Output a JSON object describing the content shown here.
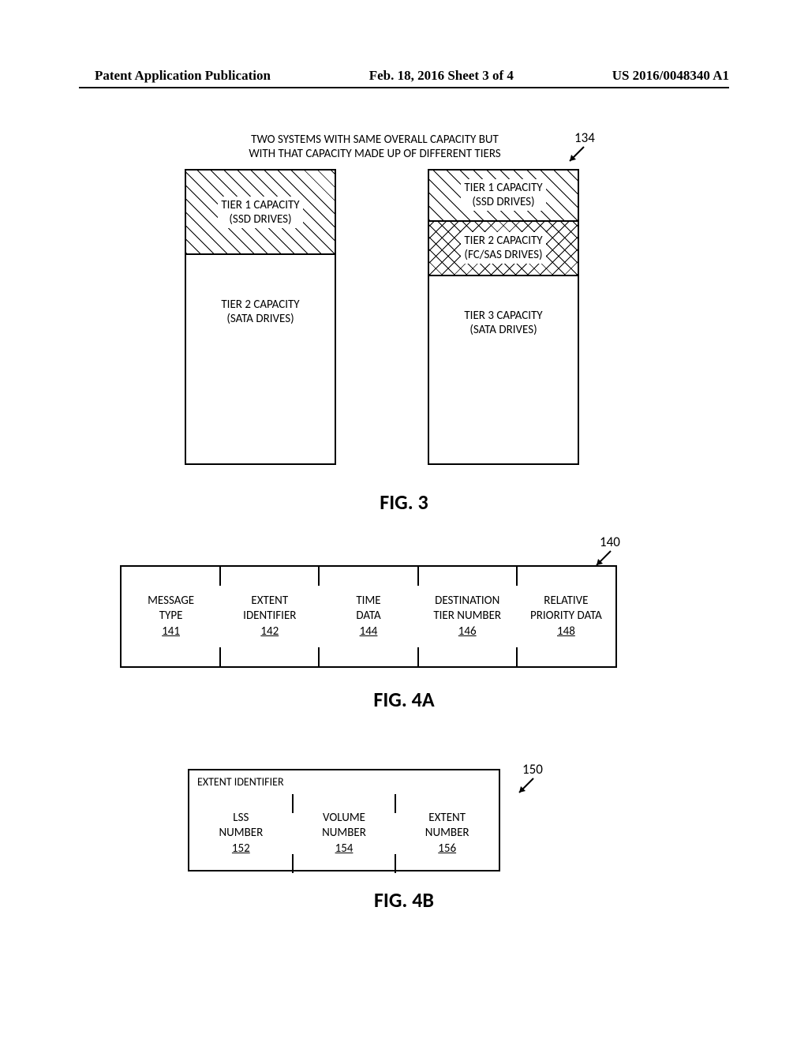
{
  "header": {
    "left": "Patent Application Publication",
    "center": "Feb. 18, 2016  Sheet 3 of 4",
    "right": "US 2016/0048340 A1"
  },
  "fig3": {
    "caption": "TWO SYSTEMS WITH SAME OVERALL CAPACITY BUT WITH THAT CAPACITY MADE UP OF DIFFERENT TIERS",
    "ref": "134",
    "system_a": {
      "tier1_line1": "TIER 1 CAPACITY",
      "tier1_line2": "(SSD DRIVES)",
      "tier2_line1": "TIER 2 CAPACITY",
      "tier2_line2": "(SATA DRIVES)"
    },
    "system_b": {
      "tier1_line1": "TIER 1 CAPACITY",
      "tier1_line2": "(SSD DRIVES)",
      "tier2_line1": "TIER 2 CAPACITY",
      "tier2_line2": "(FC/SAS DRIVES)",
      "tier3_line1": "TIER 3 CAPACITY",
      "tier3_line2": "(SATA DRIVES)"
    },
    "label": "FIG. 3"
  },
  "fig4a": {
    "ref": "140",
    "cells": [
      {
        "l1": "MESSAGE",
        "l2": "TYPE",
        "num": "141"
      },
      {
        "l1": "EXTENT",
        "l2": "IDENTIFIER",
        "num": "142"
      },
      {
        "l1": "TIME",
        "l2": "DATA",
        "num": "144"
      },
      {
        "l1": "DESTINATION",
        "l2": "TIER NUMBER",
        "num": "146"
      },
      {
        "l1": "RELATIVE",
        "l2": "PRIORITY DATA",
        "num": "148"
      }
    ],
    "label": "FIG. 4A"
  },
  "fig4b": {
    "ref": "150",
    "title": "EXTENT IDENTIFIER",
    "cells": [
      {
        "l1": "LSS",
        "l2": "NUMBER",
        "num": "152"
      },
      {
        "l1": "VOLUME",
        "l2": "NUMBER",
        "num": "154"
      },
      {
        "l1": "EXTENT",
        "l2": "NUMBER",
        "num": "156"
      }
    ],
    "label": "FIG. 4B"
  }
}
